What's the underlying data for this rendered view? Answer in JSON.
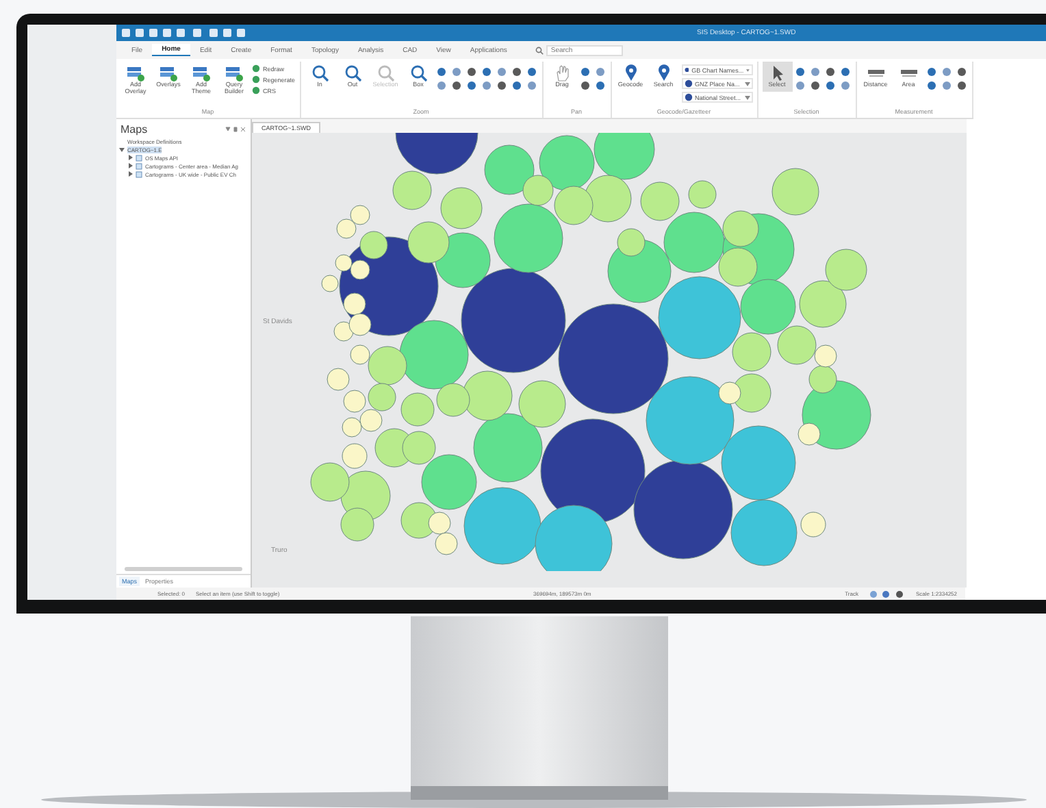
{
  "window": {
    "title": "SIS Desktop - CARTOG~1.SWD"
  },
  "menu_tabs": [
    {
      "label": "File",
      "selected": false
    },
    {
      "label": "Home",
      "selected": true
    },
    {
      "label": "Edit",
      "selected": false
    },
    {
      "label": "Create",
      "selected": false
    },
    {
      "label": "Format",
      "selected": false
    },
    {
      "label": "Topology",
      "selected": false
    },
    {
      "label": "Analysis",
      "selected": false
    },
    {
      "label": "CAD",
      "selected": false
    },
    {
      "label": "View",
      "selected": false
    },
    {
      "label": "Applications",
      "selected": false
    }
  ],
  "search": {
    "placeholder": "Search"
  },
  "ribbon_groups": [
    {
      "label": "Map",
      "buttons": [
        {
          "label": "Add Overlay",
          "kind": "large"
        },
        {
          "label": "Overlays",
          "kind": "large"
        },
        {
          "label": "Add Theme",
          "kind": "large"
        },
        {
          "label": "Query Builder",
          "kind": "large"
        },
        {
          "label": "Redraw",
          "kind": "small"
        },
        {
          "label": "Regenerate",
          "kind": "small"
        },
        {
          "label": "CRS",
          "kind": "small"
        }
      ]
    },
    {
      "label": "Zoom",
      "buttons": [
        {
          "label": "In",
          "kind": "large",
          "disabled": false
        },
        {
          "label": "Out",
          "kind": "large",
          "disabled": false
        },
        {
          "label": "Selection",
          "kind": "large",
          "disabled": true
        },
        {
          "label": "Box",
          "kind": "large",
          "disabled": false
        }
      ]
    },
    {
      "label": "Pan",
      "buttons": [
        {
          "label": "Drag",
          "kind": "large"
        }
      ]
    },
    {
      "label": "Geocode/Gazetteer",
      "buttons": [
        {
          "label": "Geocode",
          "kind": "large"
        },
        {
          "label": "Search",
          "kind": "large"
        },
        {
          "label": "GB Chart Names...",
          "kind": "dropdown"
        },
        {
          "label": "GNZ Place Na...",
          "kind": "dropdown"
        },
        {
          "label": "National Street...",
          "kind": "dropdown"
        }
      ]
    },
    {
      "label": "Selection",
      "buttons": [
        {
          "label": "Select",
          "kind": "large",
          "selected": true
        }
      ]
    },
    {
      "label": "Measurement",
      "buttons": [
        {
          "label": "Distance",
          "kind": "large"
        },
        {
          "label": "Area",
          "kind": "large"
        }
      ]
    }
  ],
  "panel": {
    "title": "Maps",
    "tree": [
      {
        "label": "Workspace Definitions",
        "selected": false
      },
      {
        "label": "CARTOG~1.E",
        "selected": true,
        "expanded": true,
        "children": [
          {
            "label": "OS Maps API",
            "selected": false,
            "expanded": false
          },
          {
            "label": "Cartograms - Center area - Median Ag",
            "selected": false,
            "expanded": false
          },
          {
            "label": "Cartograms - UK wide - Public EV Ch",
            "selected": false,
            "expanded": false
          }
        ]
      }
    ]
  },
  "document_tab": {
    "label": "CARTOG~1.SWD"
  },
  "map": {
    "labels": [
      "St Davids",
      "Truro"
    ]
  },
  "panel_tabs": [
    {
      "label": "Maps",
      "selected": true
    },
    {
      "label": "Properties",
      "selected": false
    }
  ],
  "status_bar": {
    "selected": "Selected: 0",
    "hint": "Select an item (use Shift to toggle)",
    "coordinates": "369694m, 189573m 0m",
    "track": "Track",
    "scale": "Scale 1:2334252"
  }
}
